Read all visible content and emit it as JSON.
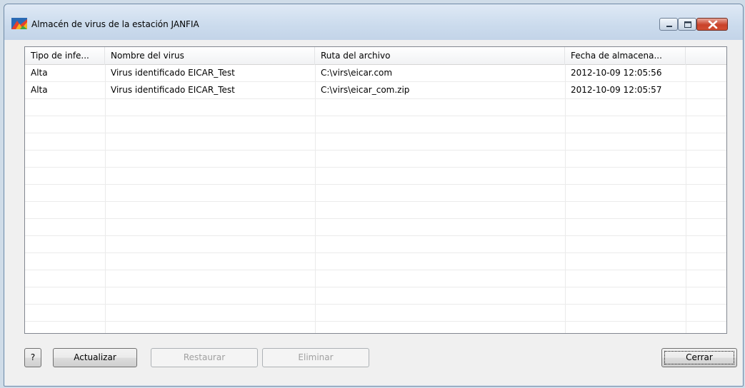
{
  "window": {
    "title": "Almacén de virus de la estación JANFIA",
    "icon": "avg-logo-icon"
  },
  "table": {
    "columns": [
      "Tipo de infe...",
      "Nombre del virus",
      "Ruta del archivo",
      "Fecha de almacena..."
    ],
    "rows": [
      [
        "Alta",
        "Virus identificado EICAR_Test",
        "C:\\virs\\eicar.com",
        "2012-10-09 12:05:56"
      ],
      [
        "Alta",
        "Virus identificado EICAR_Test",
        "C:\\virs\\eicar_com.zip",
        "2012-10-09 12:05:57"
      ]
    ]
  },
  "buttons": {
    "help": "?",
    "update": "Actualizar",
    "restore": "Restaurar",
    "delete": "Eliminar",
    "close": "Cerrar"
  }
}
